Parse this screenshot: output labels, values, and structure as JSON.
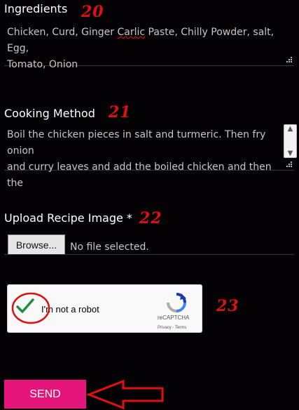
{
  "ingredients": {
    "label": "Ingredients",
    "number": "20",
    "line1_a": "Chicken, Curd, Ginger ",
    "line1_misspelled": "Carlic",
    "line1_b": " Paste, Chilly Powder, salt, Egg,",
    "line2": "Tomato, Onion"
  },
  "cooking": {
    "label": "Cooking Method",
    "number": "21",
    "line1": "Boil the chicken pieces in salt and turmeric. Then fry onion",
    "line2": "and curry leaves and add the boiled chicken and then the"
  },
  "upload": {
    "label": "Upload Recipe Image *",
    "number": "22",
    "browse_label": "Browse...",
    "file_status": "No file selected."
  },
  "captcha": {
    "number": "23",
    "label": "I'm not a robot",
    "brand": "reCAPTCHA",
    "links": "Privacy - Terms",
    "checked": true
  },
  "send": {
    "label": "SEND"
  },
  "colors": {
    "background": "#050205",
    "accent": "#e5157c",
    "annotation_red": "#e01010",
    "check_green": "#1e8e3e"
  }
}
